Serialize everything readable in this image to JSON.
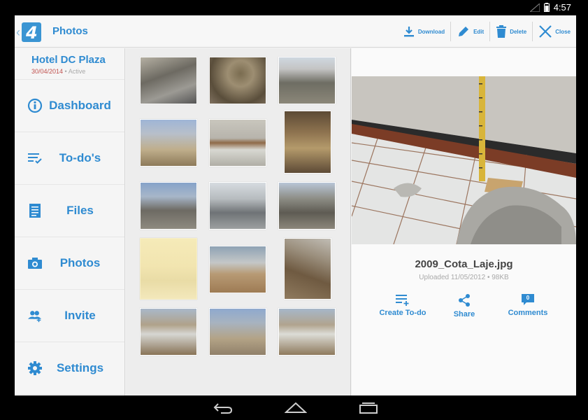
{
  "status_bar": {
    "time": "4:57"
  },
  "action_bar": {
    "title": "Photos",
    "logo_letter": "4",
    "actions": {
      "download": "Download",
      "edit": "Edit",
      "delete": "Delete",
      "close": "Close"
    }
  },
  "project": {
    "name": "Hotel DC Plaza",
    "date": "30/04/2014",
    "separator": " • ",
    "status": "Active"
  },
  "sidebar": {
    "items": [
      {
        "label": "Dashboard",
        "icon": "info-icon"
      },
      {
        "label": "To-do's",
        "icon": "todo-list-icon"
      },
      {
        "label": "Files",
        "icon": "file-icon"
      },
      {
        "label": "Photos",
        "icon": "camera-icon"
      },
      {
        "label": "Invite",
        "icon": "invite-people-icon"
      },
      {
        "label": "Settings",
        "icon": "gear-icon"
      }
    ]
  },
  "gallery": {
    "count": 15
  },
  "detail": {
    "file_name": "2009_Cota_Laje.jpg",
    "meta": "Uploaded 11/05/2012 • 98KB",
    "actions": {
      "create_todo": "Create To-do",
      "share": "Share",
      "comments": "Comments",
      "comments_count": "0"
    }
  },
  "colors": {
    "accent": "#2f8bd1",
    "date": "#c0504d",
    "muted": "#a9a9a9"
  }
}
